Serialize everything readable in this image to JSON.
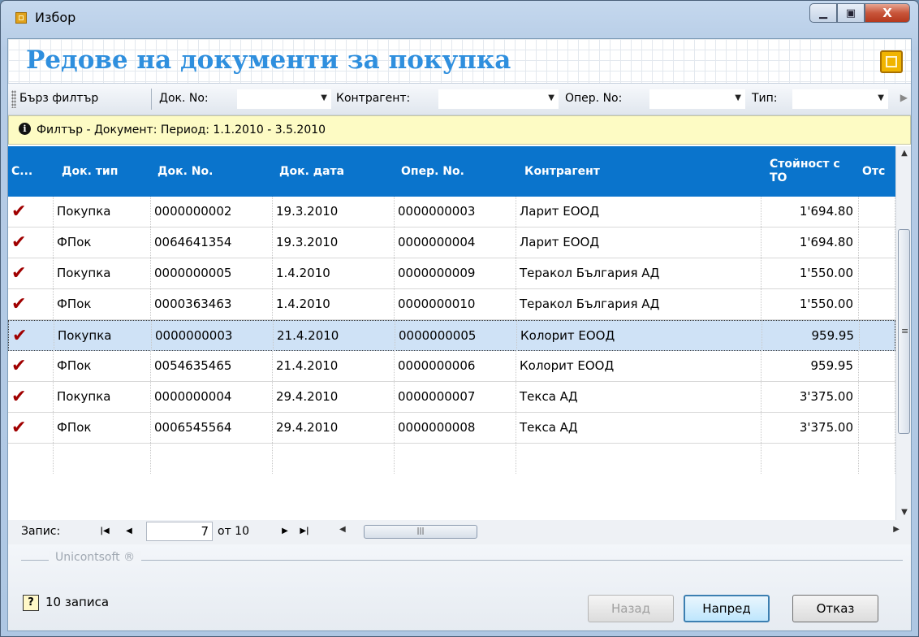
{
  "window": {
    "title": "Избор"
  },
  "header": {
    "title": "Редове на документи за покупка"
  },
  "toolbar": {
    "quick_filter": "Бърз филтър",
    "doc_no_label": "Док. No:",
    "partner_label": "Контрагент:",
    "oper_no_label": "Опер. No:",
    "type_label": "Тип:"
  },
  "filter": {
    "text": "Филтър - Документ: Период: 1.1.2010 - 3.5.2010"
  },
  "grid": {
    "columns": [
      "С...",
      "Док. тип",
      "Док. No.",
      "Док. дата",
      "Опер. No.",
      "Контрагент",
      "Стойност с ТО",
      "Отс"
    ],
    "rows": [
      {
        "type": "Покупка",
        "doc_no": "0000000002",
        "date": "19.3.2010",
        "oper_no": "0000000003",
        "partner": "Ларит ЕООД",
        "value": "1'694.80"
      },
      {
        "type": "ФПок",
        "doc_no": "0064641354",
        "date": "19.3.2010",
        "oper_no": "0000000004",
        "partner": "Ларит ЕООД",
        "value": "1'694.80"
      },
      {
        "type": "Покупка",
        "doc_no": "0000000005",
        "date": "1.4.2010",
        "oper_no": "0000000009",
        "partner": "Теракол България АД",
        "value": "1'550.00"
      },
      {
        "type": "ФПок",
        "doc_no": "0000363463",
        "date": "1.4.2010",
        "oper_no": "0000000010",
        "partner": "Теракол България АД",
        "value": "1'550.00"
      },
      {
        "type": "Покупка",
        "doc_no": "0000000003",
        "date": "21.4.2010",
        "oper_no": "0000000005",
        "partner": "Колорит ЕООД",
        "value": "959.95"
      },
      {
        "type": "ФПок",
        "doc_no": "0054635465",
        "date": "21.4.2010",
        "oper_no": "0000000006",
        "partner": "Колорит ЕООД",
        "value": "959.95"
      },
      {
        "type": "Покупка",
        "doc_no": "0000000004",
        "date": "29.4.2010",
        "oper_no": "0000000007",
        "partner": "Текса АД",
        "value": "3'375.00"
      },
      {
        "type": "ФПок",
        "doc_no": "0006545564",
        "date": "29.4.2010",
        "oper_no": "0000000008",
        "partner": "Текса АД",
        "value": "3'375.00"
      }
    ],
    "selected_row": 4
  },
  "nav": {
    "label": "Запис:",
    "current": "7",
    "of_text": "от 10"
  },
  "footer": {
    "brand": "Unicontsoft ®",
    "count": "10 записа",
    "back": "Назад",
    "next": "Напред",
    "cancel": "Отказ"
  },
  "colors": {
    "header_blue": "#0a74cc",
    "title_blue": "#2f8fde",
    "filter_yellow": "#fdfbc4",
    "check_red": "#a00000"
  }
}
